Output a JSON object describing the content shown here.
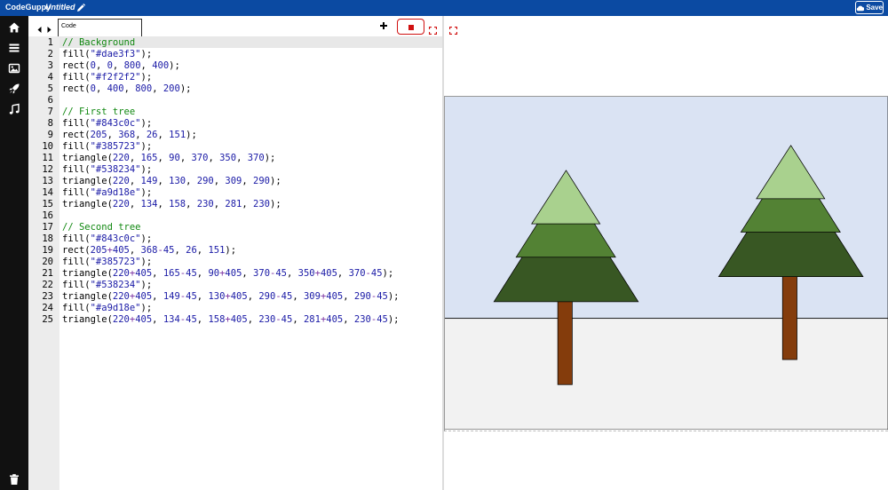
{
  "topbar": {
    "brand": "CodeGuppy",
    "doc_title": "Untitled",
    "save_label": "Save",
    "bg_color": "#0b4aa2"
  },
  "sidebar": {
    "items": [
      {
        "icon": "home-icon"
      },
      {
        "icon": "menu-icon"
      },
      {
        "icon": "image-icon"
      },
      {
        "icon": "rocket-icon"
      },
      {
        "icon": "music-icon"
      },
      {
        "icon": "trash-icon"
      }
    ]
  },
  "editor": {
    "tab_label": "Code",
    "line_numbers": [
      "1",
      "2",
      "3",
      "4",
      "5",
      "6",
      "7",
      "8",
      "9",
      "10",
      "11",
      "12",
      "13",
      "14",
      "15",
      "16",
      "17",
      "18",
      "19",
      "20",
      "21",
      "22",
      "23",
      "24",
      "25"
    ],
    "lines": [
      "// Background",
      "fill(\"#dae3f3\");",
      "rect(0, 0, 800, 400);",
      "fill(\"#f2f2f2\");",
      "rect(0, 400, 800, 200);",
      "",
      "// First tree",
      "fill(\"#843c0c\");",
      "rect(205, 368, 26, 151);",
      "fill(\"#385723\");",
      "triangle(220, 165, 90, 370, 350, 370);",
      "fill(\"#538234\");",
      "triangle(220, 149, 130, 290, 309, 290);",
      "fill(\"#a9d18e\");",
      "triangle(220, 134, 158, 230, 281, 230);",
      "",
      "// Second tree",
      "fill(\"#843c0c\");",
      "rect(205+405, 368-45, 26, 151);",
      "fill(\"#385723\");",
      "triangle(220+405, 165-45, 90+405, 370-45, 350+405, 370-45);",
      "fill(\"#538234\");",
      "triangle(220+405, 149-45, 130+405, 290-45, 309+405, 290-45);",
      "fill(\"#a9d18e\");",
      "triangle(220+405, 134-45, 158+405, 230-45, 281+405, 230-45);"
    ]
  },
  "output": {
    "colors": {
      "sky": "#dae3f3",
      "ground": "#f2f2f2",
      "trunk": "#843c0c",
      "dark_green": "#385723",
      "mid_green": "#538234",
      "light_green": "#a9d18e"
    }
  }
}
